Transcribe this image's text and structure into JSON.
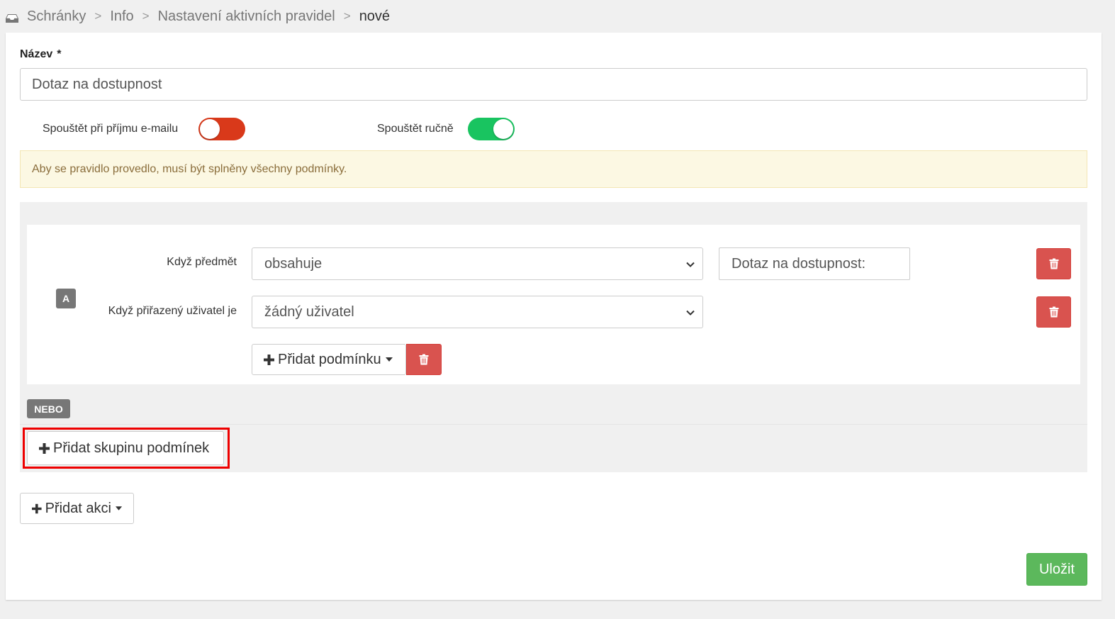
{
  "breadcrumb": {
    "icon": "inbox-icon",
    "items": [
      "Schránky",
      "Info",
      "Nastavení aktivních pravidel"
    ],
    "current": "nové",
    "separator": ">"
  },
  "form": {
    "name_label": "Název",
    "required_mark": "*",
    "name_value": "Dotaz na dostupnost",
    "toggle_on_receive_label": "Spouštět při příjmu e-mailu",
    "toggle_on_receive_state": false,
    "toggle_manual_label": "Spouštět ručně",
    "toggle_manual_state": true,
    "alert_text": "Aby se pravidlo provedlo, musí být splněny všechny podmínky."
  },
  "conditions": {
    "group_badge": "A",
    "rows": [
      {
        "label": "Když předmět",
        "operator": "obsahuje",
        "value": "Dotaz na dostupnost:"
      },
      {
        "label": "Když přiřazený uživatel je",
        "operator": "žádný uživatel"
      }
    ],
    "add_condition_label": "Přidat podmínku",
    "or_badge": "NEBO",
    "add_group_label": "Přidat skupinu podmínek"
  },
  "actions": {
    "add_action_label": "Přidat akci",
    "save_label": "Uložit"
  },
  "colors": {
    "danger": "#d9534f",
    "success": "#5cb85c",
    "toggle_off": "#d9391a",
    "toggle_on": "#19c460",
    "alert_bg": "#fcf8e3",
    "alert_text": "#8a6d3b",
    "highlight": "#ee0000"
  }
}
